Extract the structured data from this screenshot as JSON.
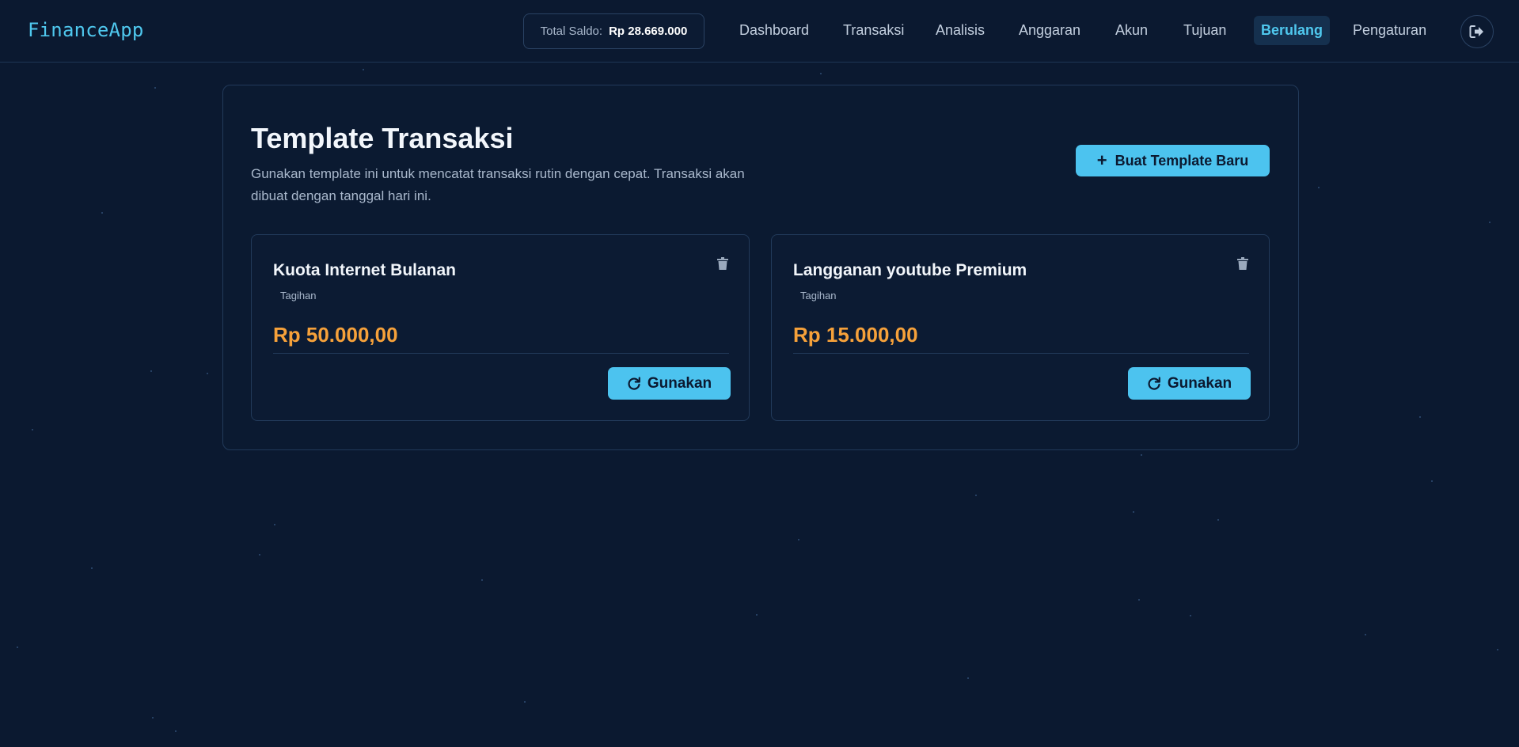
{
  "app": {
    "name": "FinanceApp"
  },
  "balance": {
    "label": "Total Saldo:",
    "value": "Rp 28.669.000"
  },
  "nav": [
    {
      "label": "Dashboard",
      "active": false
    },
    {
      "label": "Transaksi",
      "active": false
    },
    {
      "label": "Analisis",
      "active": false
    },
    {
      "label": "Anggaran",
      "active": false
    },
    {
      "label": "Akun",
      "active": false
    },
    {
      "label": "Tujuan",
      "active": false
    },
    {
      "label": "Berulang",
      "active": true
    },
    {
      "label": "Pengaturan",
      "active": false
    }
  ],
  "logout_icon": "sign-out-icon",
  "page": {
    "title": "Template Transaksi",
    "description": "Gunakan template ini untuk mencatat transaksi rutin dengan cepat. Transaksi akan dibuat dengan tanggal hari ini.",
    "new_button": "Buat Template Baru"
  },
  "templates": [
    {
      "name": "Kuota Internet Bulanan",
      "category": "Tagihan",
      "amount": "Rp 50.000,00",
      "use_label": "Gunakan"
    },
    {
      "name": "Langganan youtube Premium",
      "category": "Tagihan",
      "amount": "Rp 15.000,00",
      "use_label": "Gunakan"
    }
  ],
  "colors": {
    "background": "#0b1930",
    "accent": "#4cc3ef",
    "amount": "#f6a13a",
    "brand": "#4fc8ee"
  }
}
